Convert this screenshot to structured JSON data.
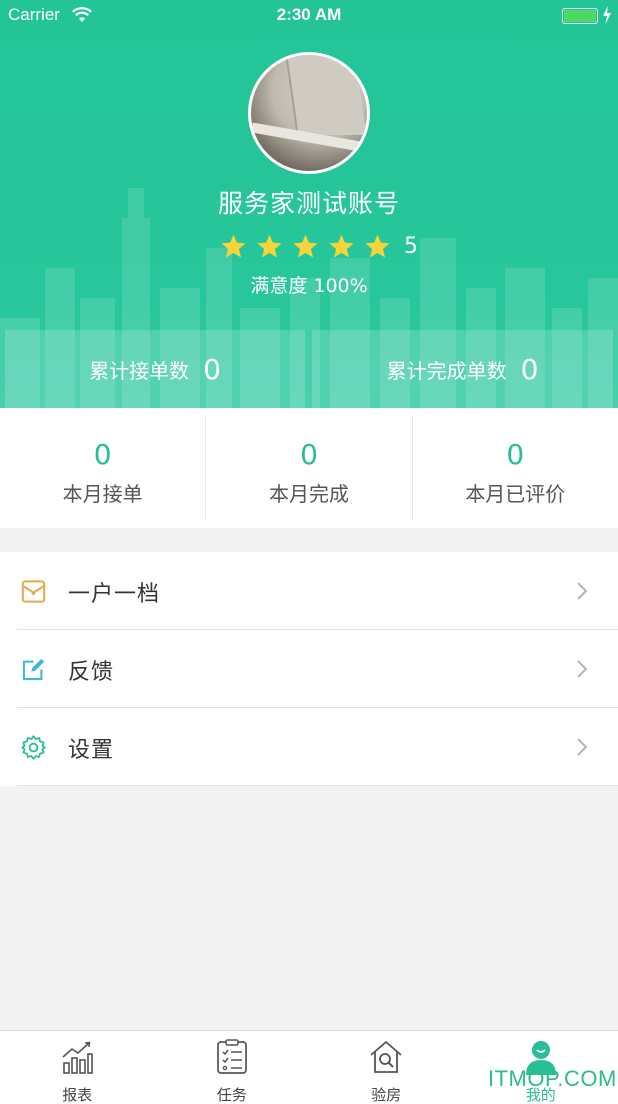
{
  "status_bar": {
    "carrier": "Carrier",
    "time": "2:30 AM"
  },
  "profile": {
    "name": "服务家测试账号",
    "rating": "5",
    "star_count": 5,
    "satisfaction": "满意度 100%"
  },
  "totals": {
    "accepted_label": "累计接单数",
    "accepted_value": "0",
    "completed_label": "累计完成单数",
    "completed_value": "0"
  },
  "monthly": [
    {
      "value": "0",
      "label": "本月接单"
    },
    {
      "value": "0",
      "label": "本月完成"
    },
    {
      "value": "0",
      "label": "本月已评价"
    }
  ],
  "menu": [
    {
      "label": "一户一档",
      "icon": "archive-envelope-icon",
      "icon_color": "#e9a94a"
    },
    {
      "label": "反馈",
      "icon": "edit-feedback-icon",
      "icon_color": "#3fb6d8"
    },
    {
      "label": "设置",
      "icon": "gear-icon",
      "icon_color": "#27bf98"
    }
  ],
  "tabbar": [
    {
      "label": "报表",
      "icon": "chart-icon",
      "active": false
    },
    {
      "label": "任务",
      "icon": "task-list-icon",
      "active": false
    },
    {
      "label": "验房",
      "icon": "house-search-icon",
      "active": false
    },
    {
      "label": "我的",
      "icon": "user-icon",
      "active": true
    }
  ],
  "watermark": "ITMOP.COM",
  "colors": {
    "primary": "#27bf98",
    "star": "#f7d43a",
    "background": "#f3f3f4"
  }
}
